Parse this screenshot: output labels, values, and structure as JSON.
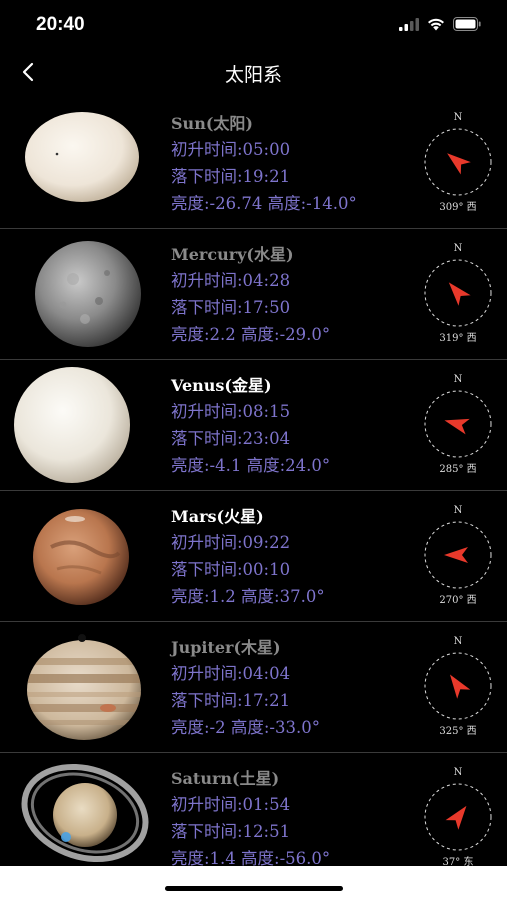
{
  "status_bar": {
    "time": "20:40"
  },
  "nav": {
    "title": "太阳系",
    "back_icon": "chevron-left-icon"
  },
  "compass_north": "N",
  "planets": [
    {
      "name": "Sun(太阳)",
      "rise": "初升时间:05:00",
      "set": "落下时间:19:21",
      "stats": "亮度:-26.74 高度:-14.0°",
      "heading": "309° 西",
      "azimuth": 309
    },
    {
      "name": "Mercury(水星)",
      "rise": "初升时间:04:28",
      "set": "落下时间:17:50",
      "stats": "亮度:2.2 高度:-29.0°",
      "heading": "319° 西",
      "azimuth": 319
    },
    {
      "name": "Venus(金星)",
      "rise": "初升时间:08:15",
      "set": "落下时间:23:04",
      "stats": "亮度:-4.1 高度:24.0°",
      "heading": "285° 西",
      "azimuth": 285
    },
    {
      "name": "Mars(火星)",
      "rise": "初升时间:09:22",
      "set": "落下时间:00:10",
      "stats": "亮度:1.2 高度:37.0°",
      "heading": "270° 西",
      "azimuth": 270
    },
    {
      "name": "Jupiter(木星)",
      "rise": "初升时间:04:04",
      "set": "落下时间:17:21",
      "stats": "亮度:-2 高度:-33.0°",
      "heading": "325° 西",
      "azimuth": 325
    },
    {
      "name": "Saturn(土星)",
      "rise": "初升时间:01:54",
      "set": "落下时间:12:51",
      "stats": "亮度:1.4 高度:-56.0°",
      "heading": "37° 东",
      "azimuth": 37
    }
  ]
}
